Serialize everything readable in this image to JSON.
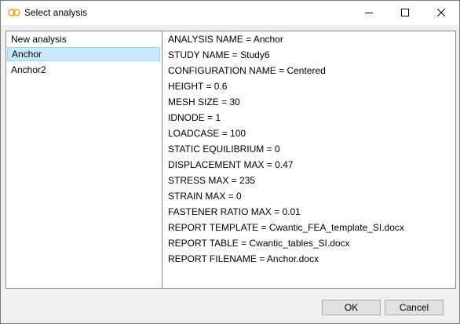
{
  "window": {
    "title": "Select analysis",
    "controls": [
      "minimize-icon",
      "maximize-icon",
      "close-icon"
    ]
  },
  "analysis_list": {
    "items": [
      "New analysis",
      "Anchor",
      "Anchor2"
    ],
    "selected": "Anchor"
  },
  "details": {
    "lines": [
      "ANALYSIS NAME = Anchor",
      "STUDY NAME = Study6",
      "CONFIGURATION NAME = Centered",
      "HEIGHT = 0.6",
      "MESH SIZE = 30",
      "IDNODE = 1",
      "LOADCASE = 100",
      "STATIC EQUILIBRIUM = 0",
      "DISPLACEMENT MAX = 0.47",
      "STRESS MAX = 235",
      "STRAIN MAX = 0",
      "FASTENER RATIO MAX = 0.01",
      "REPORT TEMPLATE = Cwantic_FEA_template_SI.docx",
      "REPORT TABLE = Cwantic_tables_SI.docx",
      "REPORT FILENAME = Anchor.docx"
    ]
  },
  "buttons": {
    "ok": "OK",
    "cancel": "Cancel"
  },
  "colors": {
    "selection_bg": "#cce8ff",
    "selection_border": "#99d1ff",
    "app_icon": "#e8a33a"
  }
}
